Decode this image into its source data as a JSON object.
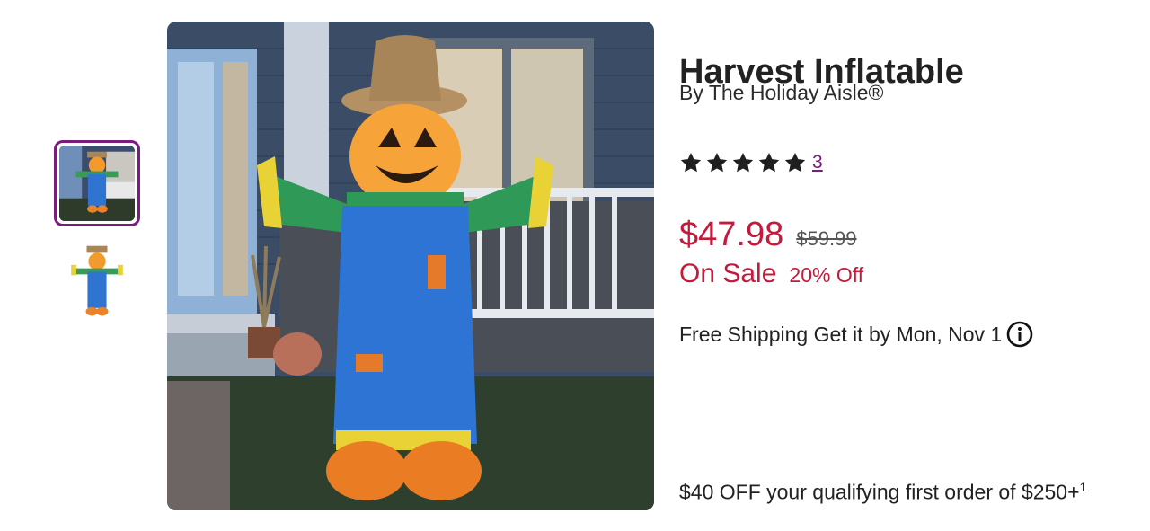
{
  "product": {
    "title": "Harvest Inflatable",
    "brand": "By The Holiday Aisle®",
    "rating": {
      "stars": 5,
      "max": 5,
      "review_count": "3"
    },
    "price": {
      "sale": "$47.98",
      "original": "$59.99",
      "on_sale_label": "On Sale",
      "discount_label": "20% Off"
    },
    "shipping": "Free Shipping Get it by Mon, Nov 1",
    "promo": {
      "text": "$40 OFF your qualifying first order of $250+",
      "footnote": "1"
    }
  },
  "gallery": {
    "thumbnails": [
      {
        "icon": "scarecrow-porch-thumbnail",
        "selected": true
      },
      {
        "icon": "scarecrow-white-thumbnail",
        "selected": false
      }
    ],
    "main_icon": "scarecrow-inflatable-photo"
  },
  "colors": {
    "accent_purple": "#7b1b7e",
    "sale_red": "#c41a3b",
    "star": "#1f1f1f"
  }
}
